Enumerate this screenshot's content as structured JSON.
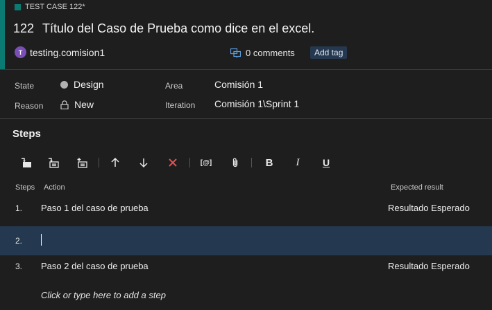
{
  "header": {
    "kind_label": "TEST CASE 122*",
    "id": "122",
    "title": "Título del Caso de Prueba como dice en el excel.",
    "user_initial": "T",
    "user_name": "testing.comision1",
    "comments": "0 comments",
    "add_tag": "Add tag"
  },
  "fields": {
    "state_label": "State",
    "state_value": "Design",
    "reason_label": "Reason",
    "reason_value": "New",
    "area_label": "Area",
    "area_value": "Comisión 1",
    "iteration_label": "Iteration",
    "iteration_value": "Comisión 1\\Sprint 1"
  },
  "steps": {
    "title": "Steps",
    "toolbar": {
      "bold": "B",
      "italic": "I",
      "underline": "U",
      "shared_param": "[@]"
    },
    "columns": {
      "steps": "Steps",
      "action": "Action",
      "expected": "Expected result"
    },
    "rows": [
      {
        "num": "1.",
        "action": "Paso 1 del caso de prueba",
        "expected": "Resultado Esperado"
      },
      {
        "num": "2.",
        "action": "",
        "expected": ""
      },
      {
        "num": "3.",
        "action": "Paso 2 del caso de prueba",
        "expected": "Resultado Esperado"
      }
    ],
    "add_step": "Click or type here to add a step"
  },
  "colors": {
    "accent": "#0b7a73",
    "selected_row": "#24384f",
    "delete": "#e05252",
    "avatar": "#7a4fb5"
  }
}
